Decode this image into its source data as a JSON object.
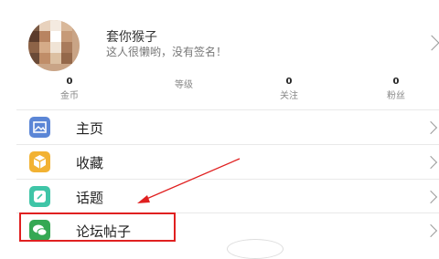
{
  "profile": {
    "username": "套你猴子",
    "signature": "这人很懒哟，没有签名！"
  },
  "stats": [
    {
      "value": "0",
      "label": "金币"
    },
    {
      "value": "",
      "label": "等级"
    },
    {
      "value": "0",
      "label": "关注"
    },
    {
      "value": "0",
      "label": "粉丝"
    }
  ],
  "menu": {
    "items": [
      {
        "label": "主页",
        "icon": "picture-icon",
        "color": "#5b86d6"
      },
      {
        "label": "收藏",
        "icon": "box-icon",
        "color": "#f2b233"
      },
      {
        "label": "话题",
        "icon": "topic-icon",
        "color": "#3fc5a7"
      },
      {
        "label": "论坛帖子",
        "icon": "chat-icon",
        "color": "#35a853"
      }
    ]
  },
  "annotation": {
    "color": "#e02020"
  }
}
